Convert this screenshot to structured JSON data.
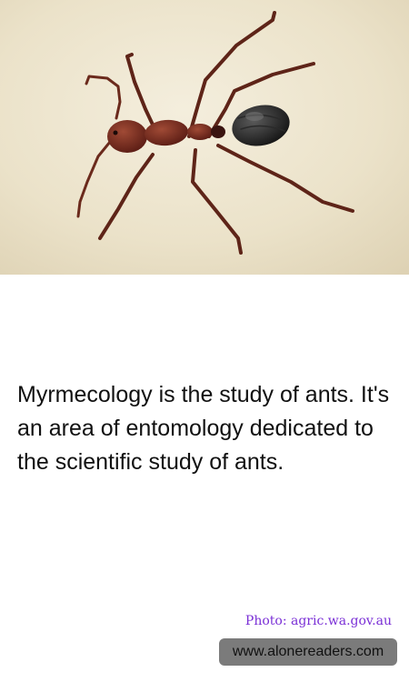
{
  "photo": {
    "subject": "ant-icon"
  },
  "fact": {
    "text": "Myrmecology is the study of ants. It's an area of entomology dedicated to the scientific study of ants."
  },
  "credit": {
    "text": "Photo: agric.wa.gov.au",
    "color": "#7a2fd6"
  },
  "watermark": {
    "text": "www.alonereaders.com",
    "background": "#7b7b7b"
  }
}
